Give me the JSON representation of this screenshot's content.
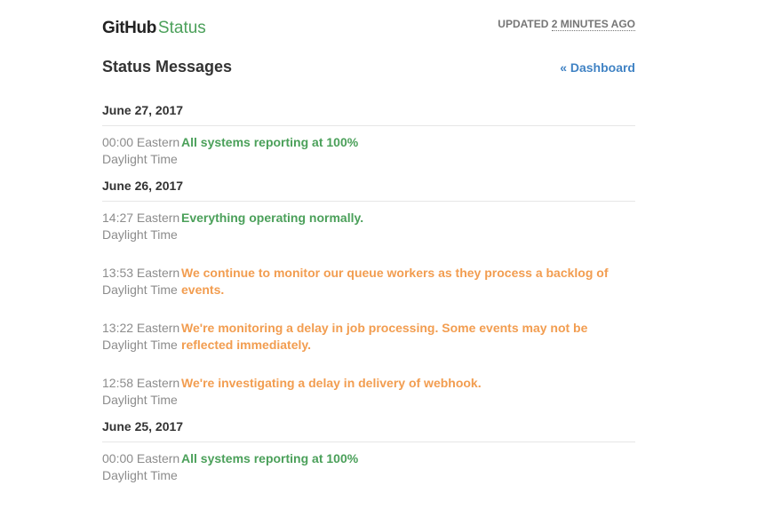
{
  "header": {
    "logo_github": "GitHub",
    "logo_status": "Status",
    "updated_prefix": "UPDATED",
    "updated_time": "2 MINUTES AGO"
  },
  "page": {
    "title": "Status Messages",
    "dashboard_link": "« Dashboard"
  },
  "colors": {
    "good": "#4ba05a",
    "minor": "#f29d50",
    "link": "#4183c4"
  },
  "days": [
    {
      "date": "June 27, 2017",
      "messages": [
        {
          "time": "00:00 Eastern Daylight Time",
          "status": "good",
          "text": "All systems reporting at 100%"
        }
      ]
    },
    {
      "date": "June 26, 2017",
      "messages": [
        {
          "time": "14:27 Eastern Daylight Time",
          "status": "good",
          "text": "Everything operating normally."
        },
        {
          "time": "13:53 Eastern Daylight Time",
          "status": "minor",
          "text": "We continue to monitor our queue workers as they process a backlog of events."
        },
        {
          "time": "13:22 Eastern Daylight Time",
          "status": "minor",
          "text": "We're monitoring a delay in job processing. Some events may not be reflected immediately."
        },
        {
          "time": "12:58 Eastern Daylight Time",
          "status": "minor",
          "text": "We're investigating a delay in delivery of webhook."
        }
      ]
    },
    {
      "date": "June 25, 2017",
      "messages": [
        {
          "time": "00:00 Eastern Daylight Time",
          "status": "good",
          "text": "All systems reporting at 100%"
        }
      ]
    }
  ]
}
